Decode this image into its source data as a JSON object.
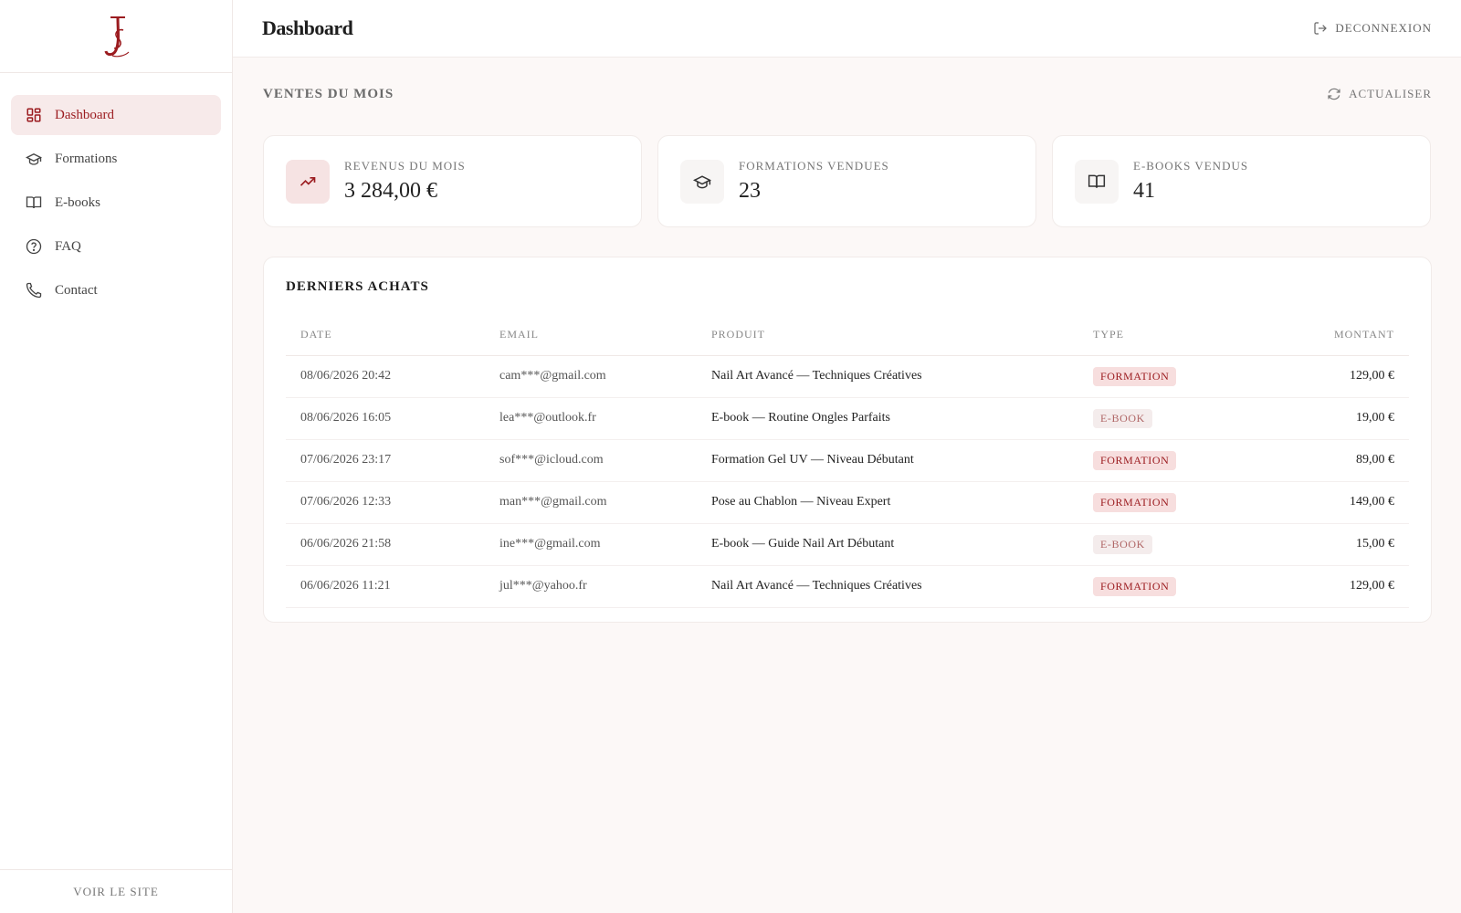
{
  "app": {
    "logo_name": "JS monogram",
    "accent_color": "#9b1b1f"
  },
  "sidebar": {
    "items": [
      {
        "label": "Dashboard",
        "icon": "dashboard-grid-icon",
        "active": true
      },
      {
        "label": "Formations",
        "icon": "graduation-cap-icon",
        "active": false
      },
      {
        "label": "E-books",
        "icon": "open-book-icon",
        "active": false
      },
      {
        "label": "FAQ",
        "icon": "question-circle-icon",
        "active": false
      },
      {
        "label": "Contact",
        "icon": "phone-icon",
        "active": false
      }
    ],
    "footer_label": "VOIR LE SITE"
  },
  "header": {
    "title": "Dashboard",
    "logout_label": "DECONNEXION"
  },
  "sales": {
    "title": "VENTES DU MOIS",
    "refresh_label": "ACTUALISER",
    "cards": [
      {
        "label": "REVENUS DU MOIS",
        "value": "3 284,00 €",
        "icon": "trending-up-icon"
      },
      {
        "label": "FORMATIONS VENDUES",
        "value": "23",
        "icon": "graduation-cap-icon"
      },
      {
        "label": "E-BOOKS VENDUS",
        "value": "41",
        "icon": "open-book-icon"
      }
    ]
  },
  "purchases": {
    "title": "DERNIERS ACHATS",
    "columns": [
      "DATE",
      "EMAIL",
      "PRODUIT",
      "TYPE",
      "MONTANT"
    ],
    "rows": [
      {
        "date": "08/06/2026 20:42",
        "email": "cam***@gmail.com",
        "product": "Nail Art Avancé — Techniques Créatives",
        "type": "FORMATION",
        "amount": "129,00 €"
      },
      {
        "date": "08/06/2026 16:05",
        "email": "lea***@outlook.fr",
        "product": "E-book — Routine Ongles Parfaits",
        "type": "E-BOOK",
        "amount": "19,00 €"
      },
      {
        "date": "07/06/2026 23:17",
        "email": "sof***@icloud.com",
        "product": "Formation Gel UV — Niveau Débutant",
        "type": "FORMATION",
        "amount": "89,00 €"
      },
      {
        "date": "07/06/2026 12:33",
        "email": "man***@gmail.com",
        "product": "Pose au Chablon — Niveau Expert",
        "type": "FORMATION",
        "amount": "149,00 €"
      },
      {
        "date": "06/06/2026 21:58",
        "email": "ine***@gmail.com",
        "product": "E-book — Guide Nail Art Débutant",
        "type": "E-BOOK",
        "amount": "15,00 €"
      },
      {
        "date": "06/06/2026 11:21",
        "email": "jul***@yahoo.fr",
        "product": "Nail Art Avancé — Techniques Créatives",
        "type": "FORMATION",
        "amount": "129,00 €"
      }
    ]
  }
}
